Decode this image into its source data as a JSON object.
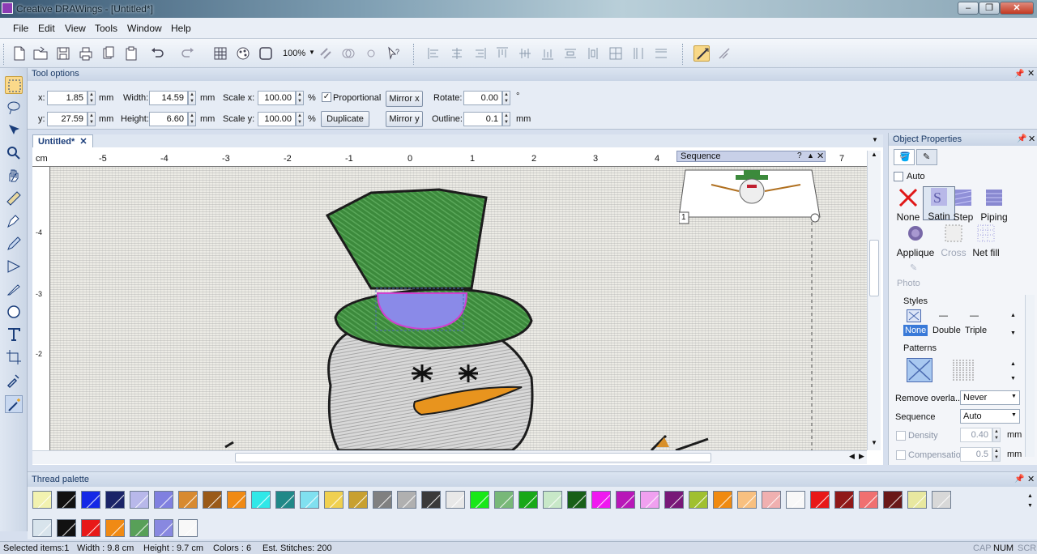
{
  "window": {
    "title": "Creative DRAWings - [Untitled*]",
    "minimize": "–",
    "maximize": "❐",
    "close": "✕"
  },
  "menu": [
    "File",
    "Edit",
    "View",
    "Tools",
    "Window",
    "Help"
  ],
  "toolbar": {
    "zoom": "100%"
  },
  "tool_options": {
    "title": "Tool options",
    "x_label": "x:",
    "x_value": "1.85",
    "y_label": "y:",
    "y_value": "27.59",
    "unit": "mm",
    "width_label": "Width:",
    "width_value": "14.59",
    "height_label": "Height:",
    "height_value": "6.60",
    "scalex_label": "Scale x:",
    "scalex_value": "100.00",
    "scaley_label": "Scale y:",
    "scaley_value": "100.00",
    "percent": "%",
    "proportional_label": "Proportional",
    "proportional_checked": "✓",
    "duplicate_label": "Duplicate",
    "mirrorx_label": "Mirror x",
    "mirrory_label": "Mirror y",
    "rotate_label": "Rotate:",
    "rotate_value": "0.00",
    "degree": "°",
    "outline_label": "Outline:",
    "outline_value": "0.1"
  },
  "document": {
    "tab_label": "Untitled*",
    "tab_close": "✕",
    "ruler_unit": "cm",
    "ruler_top": [
      "-5",
      "-4",
      "-3",
      "-2",
      "-1",
      "0",
      "1",
      "2",
      "3",
      "4",
      "5",
      "6",
      "7"
    ],
    "ruler_left": [
      "-4",
      "-3",
      "-2"
    ],
    "sequence_label": "Sequence",
    "sequence_item": "1"
  },
  "object_properties": {
    "title": "Object Properties",
    "auto_label": "Auto",
    "stitch_types": [
      "None",
      "Satin",
      "Step",
      "Piping",
      "Applique",
      "Cross",
      "Net fill"
    ],
    "photo_label": "Photo",
    "styles_label": "Styles",
    "styles": [
      "None",
      "Double",
      "Triple"
    ],
    "patterns_label": "Patterns",
    "remove_overlap_label": "Remove overla...",
    "remove_overlap_value": "Never",
    "sequence_label": "Sequence",
    "sequence_value": "Auto",
    "density_label": "Density",
    "density_value": "0.40",
    "compensation_label": "Compensation",
    "compensation_value": "0.5",
    "unit": "mm"
  },
  "thread_palette": {
    "title": "Thread palette",
    "row1": [
      "#f2f2b0",
      "#111111",
      "#1428e6",
      "#1a2468",
      "#b8b8ea",
      "#8080e0",
      "#d88a30",
      "#9a5a18",
      "#f08a14",
      "#30e8e8",
      "#208888",
      "#80e0f0",
      "#f0d050",
      "#c8a030",
      "#808080",
      "#b0b0b0",
      "#3a3a3a",
      "#e8e8e8",
      "#18e818",
      "#78b878",
      "#18a818",
      "#c8e8c8",
      "#186018",
      "#f018f0",
      "#b818b8",
      "#f0a0f0",
      "#781878",
      "#a0c030",
      "#f08a10",
      "#f8c080",
      "#f0b0b0",
      "#f8f8f8",
      "#e81818",
      "#901818",
      "#f07070",
      "#6a1818",
      "#e8e8a0",
      "#d8d8d8"
    ],
    "row2": [
      "#d8e4ec",
      "#111111",
      "#e81818",
      "#f08a14",
      "#58a058",
      "#8888e0",
      "#f8f8f8"
    ]
  },
  "status": {
    "selected": "Selected items:1",
    "width": "Width : 9.8 cm",
    "height": "Height : 9.7 cm",
    "colors": "Colors : 6",
    "stitches": "Est. Stitches: 200",
    "cap": "CAP",
    "num": "NUM",
    "scrl": "SCRL"
  }
}
